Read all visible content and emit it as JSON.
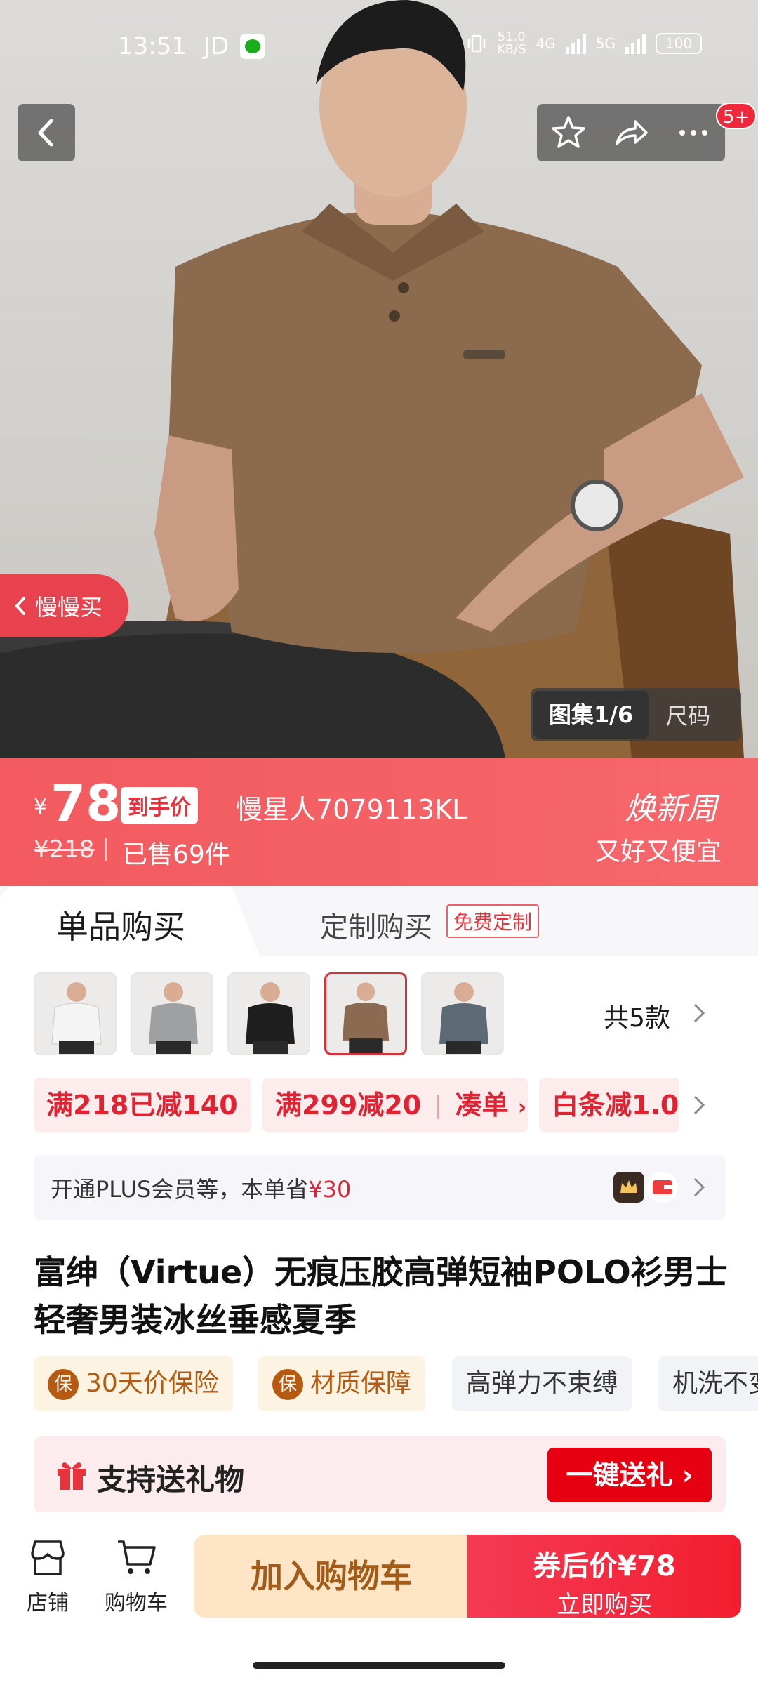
{
  "status_bar": {
    "time": "13:51",
    "carrier": "JD",
    "speed_value": "51.0",
    "speed_unit": "KB/S",
    "net1": "4G",
    "net2": "5G",
    "battery": "100"
  },
  "nav": {
    "back_icon": "chevron-left-icon",
    "favorite_icon": "star-icon",
    "share_icon": "share-icon",
    "more_icon": "more-icon",
    "message_badge": "5+"
  },
  "hero": {
    "slow_buy_label": "慢慢买",
    "gallery_label": "图集1/6",
    "size_label": "尺码"
  },
  "price": {
    "currency": "¥",
    "value": "78",
    "tag": "到手价",
    "sku": "慢星人7079113KL",
    "original": "¥218",
    "sold": "已售69件",
    "promo_title": "焕新周",
    "promo_subtitle": "又好又便宜",
    "banner_color": "#f25a5f"
  },
  "tabs": {
    "single": "单品购买",
    "custom": "定制购买",
    "custom_badge": "免费定制"
  },
  "variants": {
    "count_label": "共5款",
    "items": [
      {
        "name": "white",
        "color": "#f4f4f4"
      },
      {
        "name": "gray",
        "color": "#9ea0a2"
      },
      {
        "name": "black",
        "color": "#1e1e1e"
      },
      {
        "name": "brown",
        "color": "#8a6a50",
        "selected": true
      },
      {
        "name": "slate",
        "color": "#5d6a76"
      }
    ]
  },
  "coupons": {
    "items": [
      "满218已减140",
      "满299减20",
      "凑单",
      "白条减1.0"
    ]
  },
  "plus": {
    "text_prefix": "开通PLUS会员等，本单省",
    "saving": "¥30"
  },
  "product": {
    "title": "富绅（Virtue）无痕压胶高弹短袖POLO衫男士轻奢男装冰丝垂感夏季"
  },
  "features": {
    "items": [
      {
        "label": "30天价保险",
        "icon": "保"
      },
      {
        "label": "材质保障",
        "icon": "保"
      },
      {
        "label": "高弹力不束缚"
      },
      {
        "label": "机洗不变形"
      }
    ]
  },
  "gift": {
    "label": "支持送礼物",
    "button": "一键送礼"
  },
  "bottom_bar": {
    "store": "店铺",
    "cart": "购物车",
    "add_to_cart": "加入购物车",
    "buy_price_line": "券后价¥78",
    "buy_now": "立即购买"
  }
}
